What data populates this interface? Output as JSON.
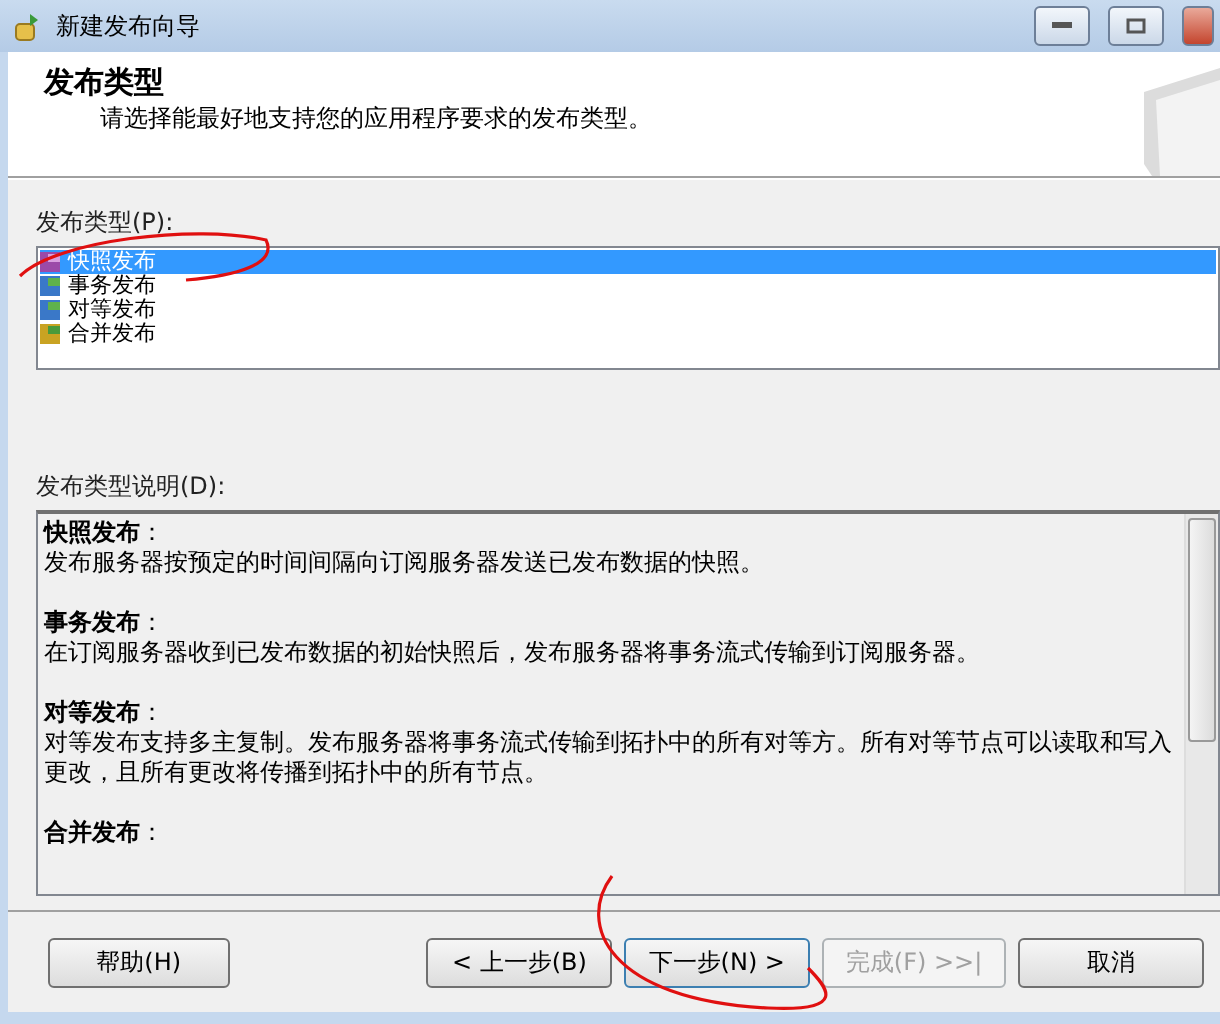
{
  "window": {
    "title": "新建发布向导"
  },
  "header": {
    "title": "发布类型",
    "subtitle": "请选择能最好地支持您的应用程序要求的发布类型。"
  },
  "type_list": {
    "label": "发布类型(P):",
    "items": [
      {
        "label": "快照发布",
        "kind": "snapshot",
        "selected": true
      },
      {
        "label": "事务发布",
        "kind": "transactional",
        "selected": false
      },
      {
        "label": "对等发布",
        "kind": "peer",
        "selected": false
      },
      {
        "label": "合并发布",
        "kind": "merge",
        "selected": false
      }
    ]
  },
  "description": {
    "label": "发布类型说明(D):",
    "sections": [
      {
        "heading": "**快照发布**：",
        "text": "发布服务器按预定的时间间隔向订阅服务器发送已发布数据的快照。"
      },
      {
        "heading": "**事务发布**：",
        "text": "在订阅服务器收到已发布数据的初始快照后，发布服务器将事务流式传输到订阅服务器。"
      },
      {
        "heading": "**对等发布**：",
        "text": "对等发布支持多主复制。发布服务器将事务流式传输到拓扑中的所有对等方。所有对等节点可以读取和写入更改，且所有更改将传播到拓扑中的所有节点。"
      },
      {
        "heading": "**合并发布**："
      }
    ]
  },
  "buttons": [
    {
      "label": "帮助(H)",
      "kind": "help",
      "disabled": false,
      "focused": false
    },
    {
      "label": "< 上一步(B)",
      "kind": "nav",
      "disabled": false,
      "focused": false
    },
    {
      "label": "下一步(N) >",
      "kind": "nav",
      "disabled": false,
      "focused": true
    },
    {
      "label": "完成(F) >>|",
      "kind": "nav",
      "disabled": true,
      "focused": false
    },
    {
      "label": "取消",
      "kind": "cancel",
      "disabled": false,
      "focused": false
    }
  ]
}
